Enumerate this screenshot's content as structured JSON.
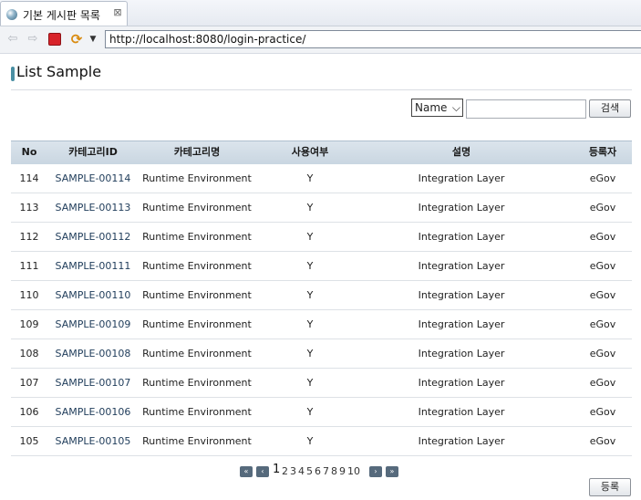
{
  "browser": {
    "tab_title": "기본 게시판 목록",
    "tab_close": "⊠",
    "url": "http://localhost:8080/login-practice/"
  },
  "page": {
    "title": "List Sample",
    "search": {
      "select_value": "Name",
      "input_value": "",
      "button_label": "검색"
    },
    "columns": [
      "No",
      "카테고리ID",
      "카테고리명",
      "사용여부",
      "설명",
      "등록자"
    ],
    "rows": [
      {
        "no": "114",
        "id": "SAMPLE-00114",
        "name": "Runtime Environment",
        "use": "Y",
        "desc": "Integration Layer",
        "reg": "eGov"
      },
      {
        "no": "113",
        "id": "SAMPLE-00113",
        "name": "Runtime Environment",
        "use": "Y",
        "desc": "Integration Layer",
        "reg": "eGov"
      },
      {
        "no": "112",
        "id": "SAMPLE-00112",
        "name": "Runtime Environment",
        "use": "Y",
        "desc": "Integration Layer",
        "reg": "eGov"
      },
      {
        "no": "111",
        "id": "SAMPLE-00111",
        "name": "Runtime Environment",
        "use": "Y",
        "desc": "Integration Layer",
        "reg": "eGov"
      },
      {
        "no": "110",
        "id": "SAMPLE-00110",
        "name": "Runtime Environment",
        "use": "Y",
        "desc": "Integration Layer",
        "reg": "eGov"
      },
      {
        "no": "109",
        "id": "SAMPLE-00109",
        "name": "Runtime Environment",
        "use": "Y",
        "desc": "Integration Layer",
        "reg": "eGov"
      },
      {
        "no": "108",
        "id": "SAMPLE-00108",
        "name": "Runtime Environment",
        "use": "Y",
        "desc": "Integration Layer",
        "reg": "eGov"
      },
      {
        "no": "107",
        "id": "SAMPLE-00107",
        "name": "Runtime Environment",
        "use": "Y",
        "desc": "Integration Layer",
        "reg": "eGov"
      },
      {
        "no": "106",
        "id": "SAMPLE-00106",
        "name": "Runtime Environment",
        "use": "Y",
        "desc": "Integration Layer",
        "reg": "eGov"
      },
      {
        "no": "105",
        "id": "SAMPLE-00105",
        "name": "Runtime Environment",
        "use": "Y",
        "desc": "Integration Layer",
        "reg": "eGov"
      }
    ],
    "pagination": {
      "first": "«",
      "prev": "‹",
      "pages": [
        "1",
        "2",
        "3",
        "4",
        "5",
        "6",
        "7",
        "8",
        "9",
        "10"
      ],
      "current": "1",
      "next": "›",
      "last": "»"
    },
    "register_label": "등록"
  },
  "colors": {
    "header_bg": "#c9d6e1",
    "link_text": "#1f3c5a",
    "stop_red": "#d8232a",
    "pager_btn": "#566a7c"
  }
}
